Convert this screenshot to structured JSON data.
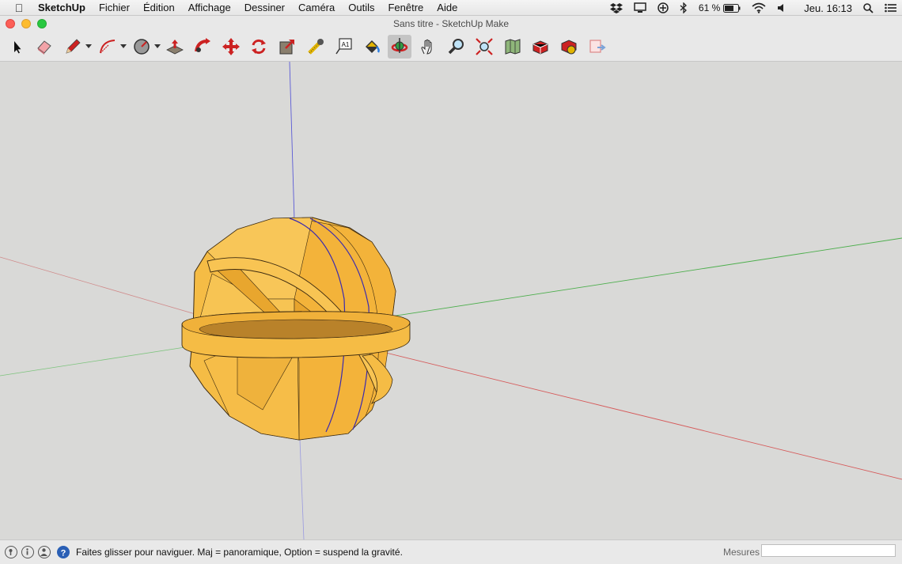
{
  "menubar": {
    "app_name": "SketchUp",
    "menus": [
      "Fichier",
      "Édition",
      "Affichage",
      "Dessiner",
      "Caméra",
      "Outils",
      "Fenêtre",
      "Aide"
    ],
    "battery": "61 %",
    "clock": "Jeu. 16:13"
  },
  "window": {
    "title": "Sans titre - SketchUp Make"
  },
  "toolbar": {
    "tools": [
      "select-tool",
      "eraser-tool",
      "pencil-tool",
      "arc-tool",
      "circle-tool",
      "push-pull-tool",
      "follow-me-tool",
      "move-tool",
      "rotate-tool",
      "scale-tool",
      "tape-measure-tool",
      "text-tool",
      "paint-bucket-tool",
      "orbit-tool",
      "pan-tool",
      "zoom-tool",
      "zoom-extents-tool",
      "warehouse-tool",
      "extension-tool",
      "extension-manager-tool",
      "layout-tool"
    ],
    "text_tool_label": "A1",
    "active": "orbit-tool"
  },
  "status": {
    "hint": "Faites glisser pour naviguer. Maj = panoramique, Option =  suspend la gravité.",
    "mesures_label": "Mesures",
    "mesures_value": ""
  },
  "colors": {
    "model_fill": "#f5bc45",
    "axis_red": "#d08a8a",
    "axis_green": "#7dc47d",
    "axis_blue": "#6c6cd4"
  }
}
